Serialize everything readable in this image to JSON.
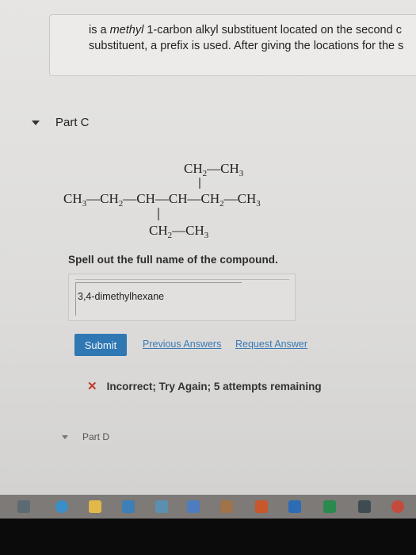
{
  "hint": {
    "line1_prefix": "is a ",
    "line1_em": "methyl",
    "line1_suffix": " 1-carbon alkyl substituent located on the second c",
    "line2": "substituent, a prefix is used. After giving the locations for the s"
  },
  "part_c": {
    "label": "Part C"
  },
  "structure": {
    "top": [
      "CH",
      "2",
      "—CH",
      "3"
    ],
    "main": [
      "CH",
      "3",
      "—CH",
      "2",
      "—CH—CH—CH",
      "2",
      "—CH",
      "3"
    ],
    "bottom": [
      "CH",
      "2",
      "—CH",
      "3"
    ]
  },
  "prompt": "Spell out the full name of the compound.",
  "answer": {
    "value": "3,4-dimethylhexane"
  },
  "buttons": {
    "submit": "Submit",
    "previous_answers": "Previous Answers",
    "request_answer": "Request Answer"
  },
  "feedback": {
    "icon": "✕",
    "text": "Incorrect; Try Again; 5 attempts remaining",
    "color": "#c0392b"
  },
  "part_d": {
    "label": "Part D"
  },
  "taskbar": {
    "icons": [
      "task-view-icon",
      "edge-icon",
      "file-explorer-icon",
      "store-icon",
      "photos-icon",
      "power-automate-icon",
      "app-icon",
      "office-icon",
      "word-icon",
      "excel-icon",
      "terminal-icon",
      "chrome-icon"
    ]
  }
}
